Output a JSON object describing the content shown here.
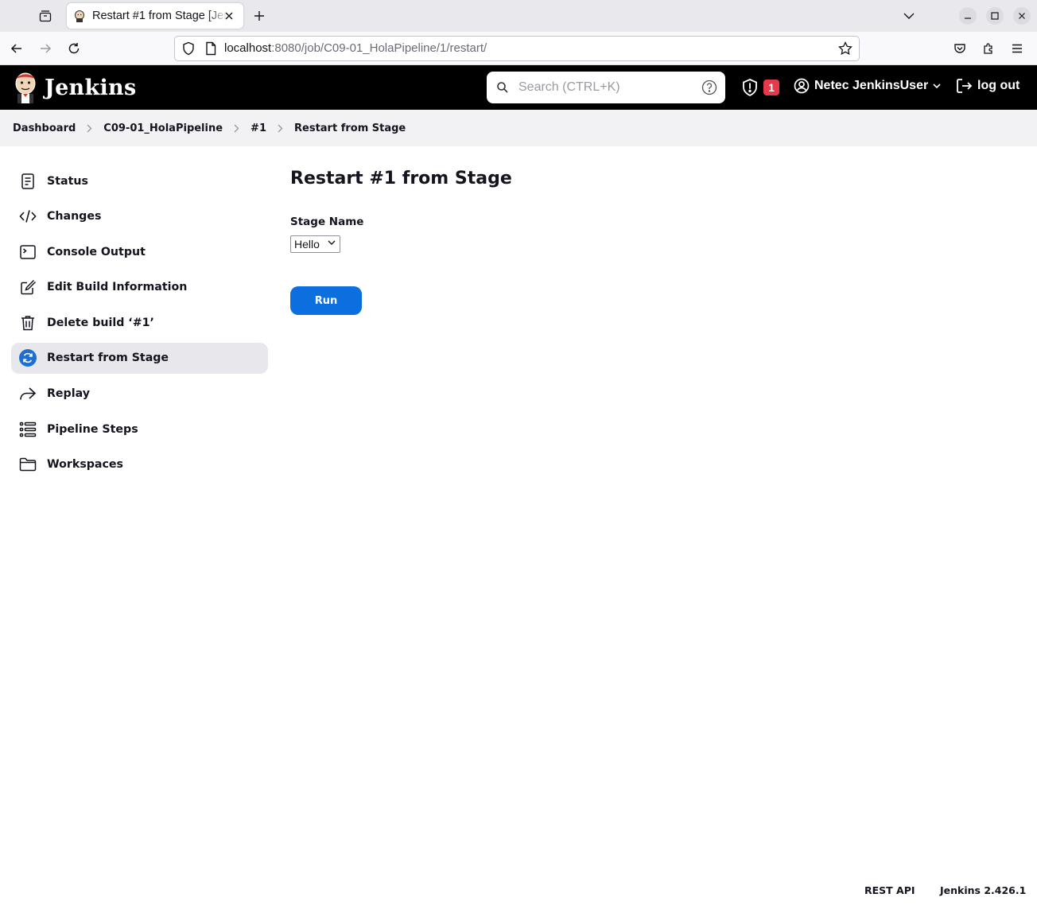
{
  "browser": {
    "tab_title": "Restart #1 from Stage [Jenkins]",
    "url_host": "localhost",
    "url_rest": ":8080/job/C09-01_HolaPipeline/1/restart/"
  },
  "header": {
    "logo_text": "Jenkins",
    "search_placeholder": "Search (CTRL+K)",
    "security_count": "1",
    "user_name": "Netec JenkinsUser",
    "logout_label": "log out"
  },
  "breadcrumbs": [
    "Dashboard",
    "C09-01_HolaPipeline",
    "#1",
    "Restart from Stage"
  ],
  "sidebar": {
    "items": [
      {
        "label": "Status",
        "icon": "document-icon"
      },
      {
        "label": "Changes",
        "icon": "code-icon"
      },
      {
        "label": "Console Output",
        "icon": "terminal-icon"
      },
      {
        "label": "Edit Build Information",
        "icon": "edit-icon"
      },
      {
        "label": "Delete build ‘#1’",
        "icon": "trash-icon"
      },
      {
        "label": "Restart from Stage",
        "icon": "restart-icon",
        "active": true
      },
      {
        "label": "Replay",
        "icon": "replay-icon"
      },
      {
        "label": "Pipeline Steps",
        "icon": "list-icon"
      },
      {
        "label": "Workspaces",
        "icon": "folder-icon"
      }
    ]
  },
  "main": {
    "title": "Restart #1 from Stage",
    "stage_label": "Stage Name",
    "stage_value": "Hello",
    "run_label": "Run"
  },
  "footer": {
    "rest_api": "REST API",
    "version": "Jenkins 2.426.1"
  },
  "colors": {
    "accent": "#0b6fe0",
    "header_bg": "#000000",
    "badge": "#e6394c",
    "active_item_bg": "#e8e8ec"
  }
}
